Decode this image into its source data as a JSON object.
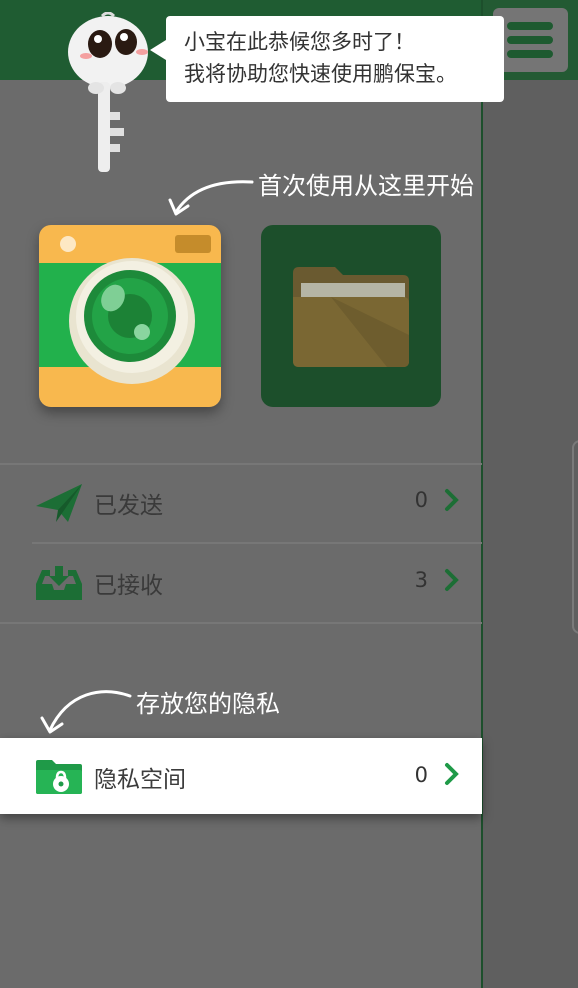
{
  "bubble": {
    "line1": "小宝在此恭候您多时了！",
    "line2": "我将协助您快速使用鹏保宝。"
  },
  "hints": {
    "first_use": "首次使用从这里开始",
    "private": "存放您的隐私"
  },
  "menu": {
    "sent": {
      "label": "已发送",
      "count": "0",
      "icon": "paper-plane-icon"
    },
    "received": {
      "label": "已接收",
      "count": "3",
      "icon": "inbox-download-icon"
    },
    "private_space": {
      "label": "隐私空间",
      "count": "0",
      "icon": "locked-folder-icon"
    }
  },
  "colors": {
    "brand_green": "#1f9a48",
    "header_green": "#1f5c32",
    "camera_orange": "#f8b84e",
    "camera_green": "#22b14c",
    "overlay_gray": "#6b6b6b"
  }
}
